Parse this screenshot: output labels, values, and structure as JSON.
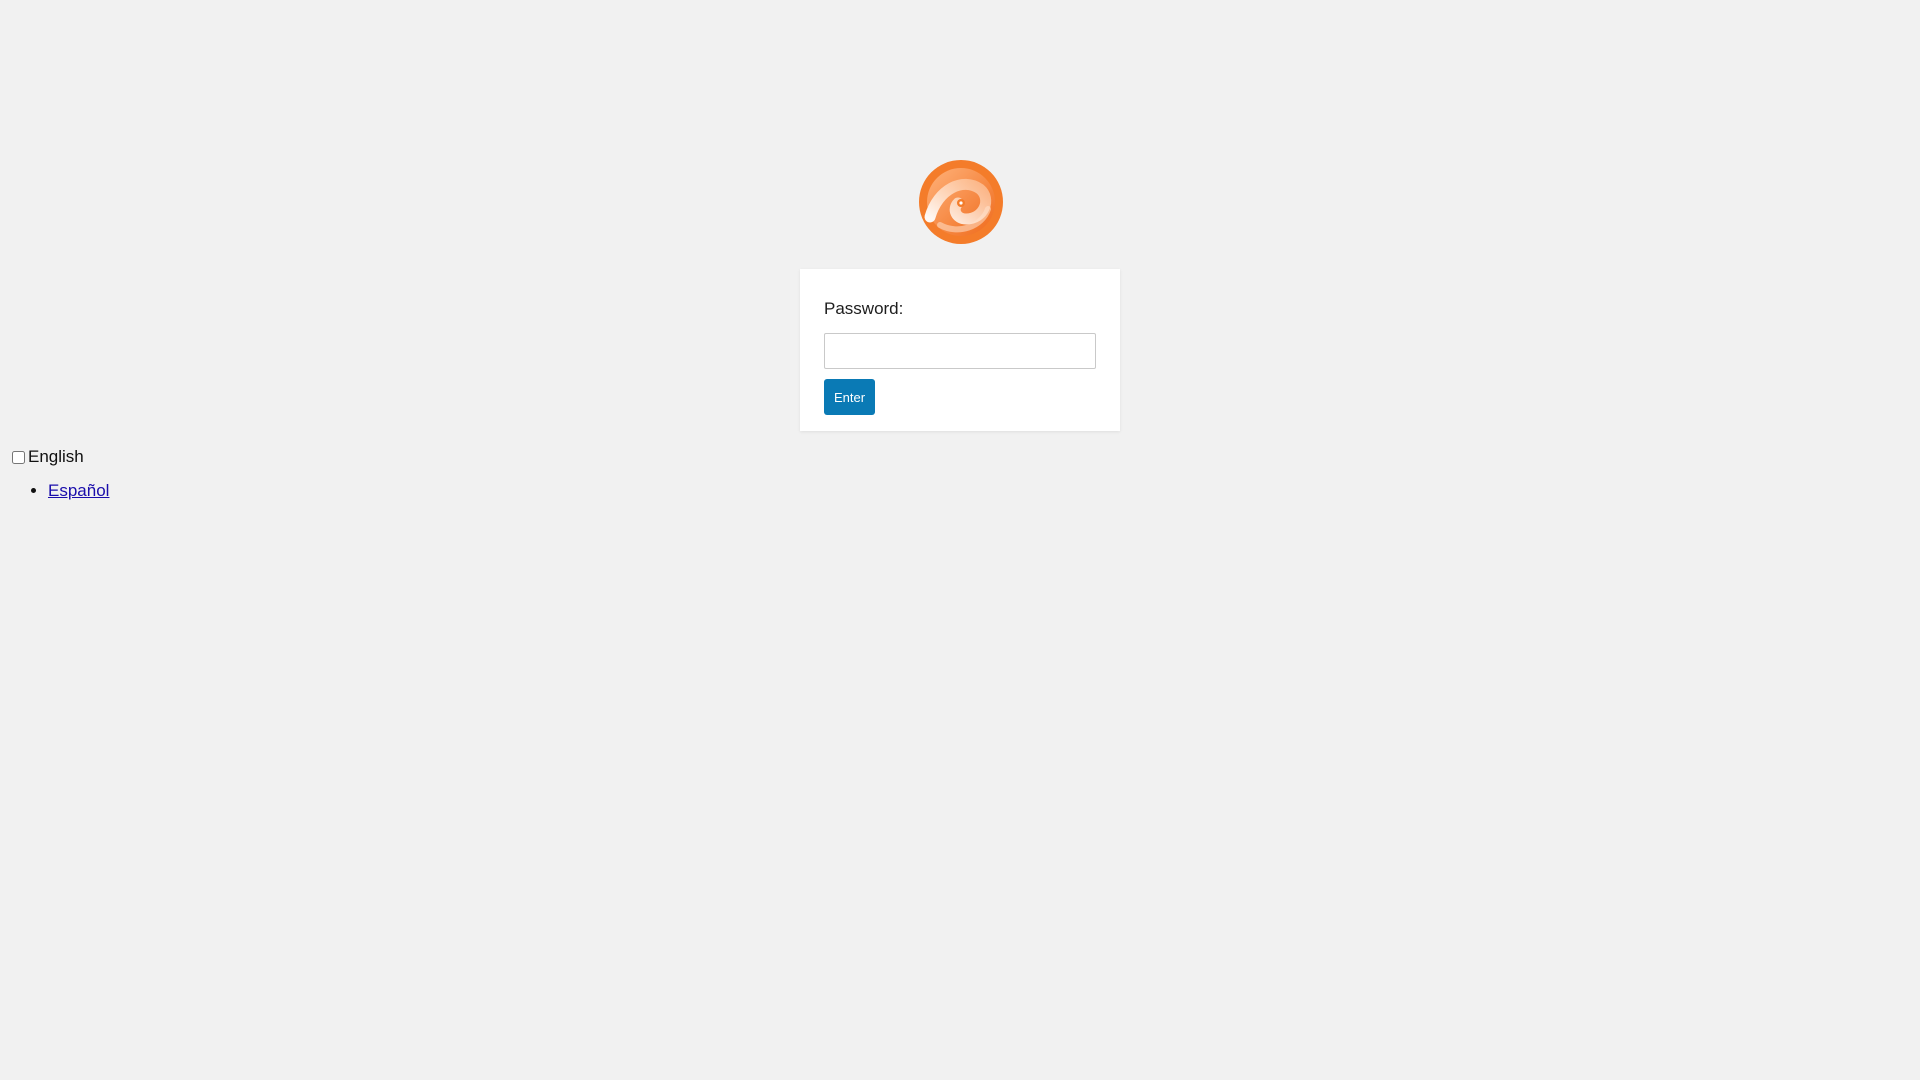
{
  "logo": {
    "icon": "orange-swirl-logo",
    "accent": "#f47c2a"
  },
  "login": {
    "password_label": "Password:",
    "password_value": "",
    "password_placeholder": "",
    "submit_label": "Enter",
    "button_color": "#0a7ab5"
  },
  "language": {
    "current": "English",
    "current_checked": false,
    "options": [
      {
        "label": "Español"
      }
    ]
  }
}
